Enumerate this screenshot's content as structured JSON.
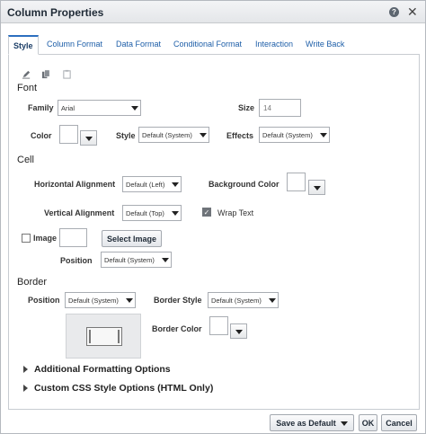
{
  "dialog": {
    "title": "Column Properties",
    "help_icon": "question-circle-icon",
    "close_icon": "close-icon"
  },
  "tabs": [
    {
      "label": "Style",
      "active": true
    },
    {
      "label": "Column Format",
      "active": false
    },
    {
      "label": "Data Format",
      "active": false
    },
    {
      "label": "Conditional Format",
      "active": false
    },
    {
      "label": "Interaction",
      "active": false
    },
    {
      "label": "Write Back",
      "active": false
    }
  ],
  "toolbar_icons": [
    "edit-pencil-icon",
    "copy-icon",
    "paste-icon"
  ],
  "font": {
    "section": "Font",
    "family_label": "Family",
    "family_value": "Arial",
    "size_label": "Size",
    "size_placeholder": "14",
    "color_label": "Color",
    "style_label": "Style",
    "style_value": "Default (System)",
    "effects_label": "Effects",
    "effects_value": "Default (System)"
  },
  "cell": {
    "section": "Cell",
    "horizontal_alignment_label": "Horizontal Alignment",
    "horizontal_alignment_value": "Default (Left)",
    "background_color_label": "Background Color",
    "vertical_alignment_label": "Vertical Alignment",
    "vertical_alignment_value": "Default (Top)",
    "wrap_text_label": "Wrap Text",
    "wrap_text_checked": true,
    "image_label": "Image",
    "image_checked": false,
    "select_image_button": "Select Image",
    "position_label": "Position",
    "position_value": "Default (System)"
  },
  "border": {
    "section": "Border",
    "position_label": "Position",
    "position_value": "Default (System)",
    "border_style_label": "Border Style",
    "border_style_value": "Default (System)",
    "border_color_label": "Border Color"
  },
  "expanders": [
    "Additional Formatting Options",
    "Custom CSS Style Options (HTML Only)"
  ],
  "footer": {
    "save_as_default": "Save as Default",
    "ok": "OK",
    "cancel": "Cancel"
  },
  "colors": {
    "accent": "#2c6fbf",
    "tab_link": "#1d5ea8"
  }
}
